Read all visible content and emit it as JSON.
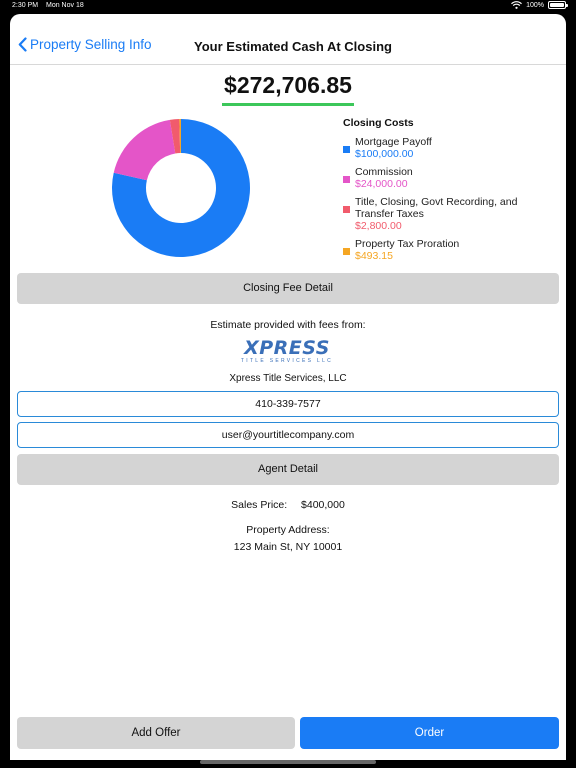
{
  "status_bar": {
    "time": "2:30 PM",
    "date": "Mon Nov 18",
    "battery": "100%",
    "battery_level": 1.0
  },
  "nav": {
    "back_label": "Property Selling Info",
    "title": "Your Estimated Cash At Closing"
  },
  "estimated_cash": "$272,706.85",
  "chart_data": {
    "type": "pie",
    "title": "Closing Costs",
    "categories": [
      "Mortgage Payoff",
      "Commission",
      "Title, Closing, Govt Recording, and Transfer Taxes",
      "Property Tax Proration"
    ],
    "values": [
      100000.0,
      24000.0,
      2800.0,
      493.15
    ],
    "colors": [
      "#1a7cf5",
      "#e455c8",
      "#f15b6c",
      "#f5a623"
    ]
  },
  "legend": {
    "title": "Closing Costs",
    "items": [
      {
        "label": "Mortgage Payoff",
        "value": "$100,000.00",
        "color": "#1a7cf5"
      },
      {
        "label": "Commission",
        "value": "$24,000.00",
        "color": "#e455c8"
      },
      {
        "label": "Title, Closing, Govt Recording, and Transfer Taxes",
        "value": "$2,800.00",
        "color": "#f15b6c"
      },
      {
        "label": "Property Tax Proration",
        "value": "$493.15",
        "color": "#f5a623"
      }
    ]
  },
  "closing_fee_button": "Closing Fee Detail",
  "estimate_label": "Estimate provided with fees from:",
  "logo": {
    "main": "XPRESS",
    "sub": "TITLE SERVICES LLC"
  },
  "company_name": "Xpress Title Services, LLC",
  "phone": "410-339-7577",
  "email": "user@yourtitlecompany.com",
  "agent_detail_button": "Agent Detail",
  "sales_price_label": "Sales Price:",
  "sales_price_value": "$400,000",
  "property_address_label": "Property Address:",
  "property_address_value": "123 Main St, NY 10001",
  "bottom": {
    "add_offer": "Add Offer",
    "order": "Order"
  }
}
